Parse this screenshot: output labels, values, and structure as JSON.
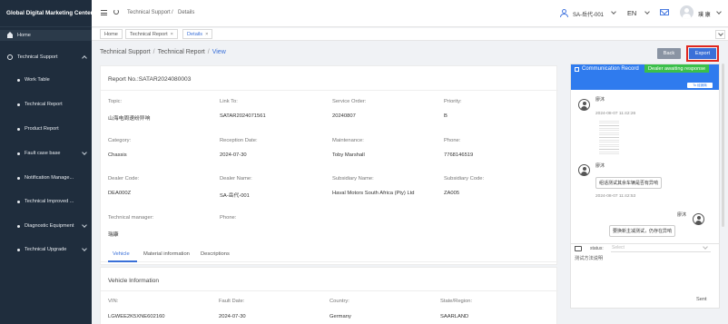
{
  "app": {
    "title": "Global Digital Marketing Center"
  },
  "sidebar": {
    "items": [
      {
        "label": "Home",
        "icon": "home-icon"
      },
      {
        "label": "Technical Support",
        "icon": "gear-icon"
      },
      {
        "label": "Work Table"
      },
      {
        "label": "Technical Report"
      },
      {
        "label": "Product Report"
      },
      {
        "label": "Fault case base"
      },
      {
        "label": "Notification Manage..."
      },
      {
        "label": "Technical Improved ..."
      },
      {
        "label": "Diagnostic Equipment"
      },
      {
        "label": "Technical Upgrade"
      }
    ]
  },
  "topbar": {
    "crumb_parent": "Technical Support",
    "crumb_sep": "/",
    "crumb_current": "Details",
    "user_code": "SA-岳代-001",
    "language": "EN",
    "username": "璞 康"
  },
  "tabs": [
    {
      "label": "Home"
    },
    {
      "label": "Technical Report",
      "close": "×"
    },
    {
      "label": "Details",
      "close": "×"
    }
  ],
  "breadcrumb": {
    "level1": "Technical Support",
    "level2": "Technical Report",
    "level3": "View",
    "sep": "/"
  },
  "buttons": {
    "back": "Back",
    "export": "Export"
  },
  "report": {
    "number": "Report No.:SATAR2024080003",
    "fields": [
      {
        "label": "Topic:",
        "value": "山海电周速纷异响"
      },
      {
        "label": "Link To:",
        "value": "SATAR2024071561"
      },
      {
        "label": "Service Order:",
        "value": "20240807"
      },
      {
        "label": "Priority:",
        "value": "B"
      },
      {
        "label": "Category:",
        "value": "Chassis"
      },
      {
        "label": "Reception Date:",
        "value": "2024-07-30"
      },
      {
        "label": "Maintenance:",
        "value": "Toby Marshall"
      },
      {
        "label": "Phone:",
        "value": "7768146519"
      },
      {
        "label": "Dealer Code:",
        "value": "DEA000Z"
      },
      {
        "label": "Dealer Name:",
        "value": "SA-岳代-001"
      },
      {
        "label": "Subsidiary Name:",
        "value": "Haval Motors South Africa (Pty) Ltd"
      },
      {
        "label": "Subsidiary Code:",
        "value": "ZA005"
      },
      {
        "label": "Technical manager:",
        "value": "瑞康"
      },
      {
        "label": "Phone:",
        "value": ""
      }
    ],
    "subtabs": [
      "Vehicle",
      "Material information",
      "Descriptions"
    ]
  },
  "vehicle": {
    "title": "Vehicle Information",
    "fields": [
      {
        "label": "VIN:",
        "value": "LGWEE2K5XNE602160"
      },
      {
        "label": "Fault Date:",
        "value": "2024-07-30"
      },
      {
        "label": "Country:",
        "value": "Germany"
      },
      {
        "label": "State/Region:",
        "value": "SAARLAND"
      }
    ]
  },
  "communication": {
    "title": "Communication Record",
    "status_badge": "Dealer awaiting response",
    "reply_label": "To 经销商",
    "messages": [
      {
        "name": "廖沐",
        "time": "2024-08-07 11:42:26"
      },
      {
        "name": "廖沐",
        "time": "2024-08-07 11:42:53",
        "text": "组话测试其余车辆是否有异响"
      },
      {
        "name": "廖沐",
        "text": "要换新主减测试，仍存在异响"
      }
    ],
    "status_label": "status:",
    "status_placeholder": "Select",
    "input_value": "测试方法说明",
    "send_label": "Sent"
  },
  "colors": {
    "sidebar": "#1f2d3d",
    "accent": "#3a70d8",
    "panel_header": "#2f7bee",
    "badge": "#3bbf4a",
    "highlight": "#e0271f"
  }
}
